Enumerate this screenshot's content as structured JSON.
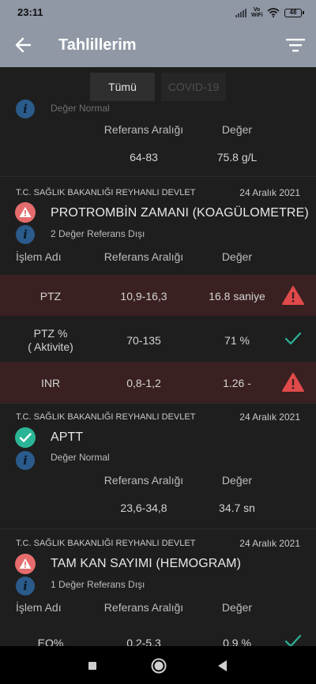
{
  "status_bar": {
    "time": "23:11",
    "volte": "Vo WiFi",
    "battery": "48"
  },
  "header": {
    "title": "Tahlillerim",
    "back_icon": "arrow-left-icon",
    "filter_icon": "filter-icon"
  },
  "filter_tabs": [
    "Tümü",
    "COVID-19"
  ],
  "colors": {
    "app_bar": "#9098a6",
    "background": "#1e1e1e",
    "alert": "#e46c6c",
    "normal": "#2bb597",
    "info": "#2a5b8b",
    "alert_row": "#3a2021"
  },
  "cards": [
    {
      "status_text": "Değer Normal",
      "columns": [
        "Referans Aralığı",
        "Değer"
      ],
      "rows": [
        {
          "range": "64-83",
          "value": "75.8 g/L"
        }
      ]
    },
    {
      "lab": "T.C. SAĞLIK BAKANLIĞI REYHANLI DEVLET",
      "date": "24 Aralık 2021",
      "title": "PROTROMBİN ZAMANI (KOAGÜLOMETRE)",
      "status_icon": "warning-icon",
      "status_text": "2 Değer Referans Dışı",
      "columns": [
        "İşlem Adı",
        "Referans Aralığı",
        "Değer"
      ],
      "rows": [
        {
          "name": "PTZ",
          "range": "10,9-16,3",
          "value": "16.8 saniye",
          "state": "alert"
        },
        {
          "name": "PTZ %\n( Aktivite)",
          "range": "70-135",
          "value": "71 %",
          "state": "normal"
        },
        {
          "name": "INR",
          "range": "0,8-1,2",
          "value": "1.26 -",
          "state": "alert"
        }
      ]
    },
    {
      "lab": "T.C. SAĞLIK BAKANLIĞI REYHANLI DEVLET",
      "date": "24 Aralık 2021",
      "title": "APTT",
      "status_icon": "check-icon",
      "status_text": "Değer Normal",
      "columns": [
        "Referans Aralığı",
        "Değer"
      ],
      "rows": [
        {
          "range": "23,6-34,8",
          "value": "34.7 sn"
        }
      ]
    },
    {
      "lab": "T.C. SAĞLIK BAKANLIĞI REYHANLI DEVLET",
      "date": "24 Aralık 2021",
      "title": "TAM KAN SAYIMI (HEMOGRAM)",
      "status_icon": "warning-icon",
      "status_text": "1 Değer Referans Dışı",
      "columns": [
        "İşlem Adı",
        "Referans Aralığı",
        "Değer"
      ],
      "rows": [
        {
          "name": "EO%",
          "range": "0,2-5,3",
          "value": "0,9 %",
          "state": "normal"
        }
      ]
    }
  ],
  "nav": [
    "recents-icon",
    "home-icon",
    "back-triangle-icon"
  ]
}
